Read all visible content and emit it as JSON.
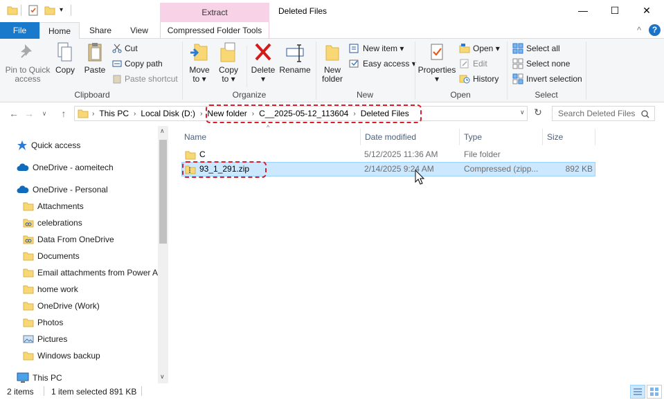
{
  "window": {
    "title": "Deleted Files",
    "context_tab_header": "Extract",
    "minimize": "—",
    "maximize": "☐",
    "close": "✕"
  },
  "ribbon_tabs": {
    "file": "File",
    "home": "Home",
    "share": "Share",
    "view": "View",
    "compressed": "Compressed Folder Tools",
    "collapse_glyph": "^",
    "help_glyph": "?"
  },
  "clipboard": {
    "pin": "Pin to Quick\naccess",
    "copy": "Copy",
    "paste": "Paste",
    "cut": "Cut",
    "copy_path": "Copy path",
    "paste_shortcut": "Paste shortcut",
    "label": "Clipboard"
  },
  "organize": {
    "move_to": "Move\nto ▾",
    "copy_to": "Copy\nto ▾",
    "delete": "Delete\n▾",
    "rename": "Rename",
    "label": "Organize"
  },
  "new": {
    "new_folder": "New\nfolder",
    "new_item": "New item ▾",
    "easy_access": "Easy access ▾",
    "label": "New"
  },
  "open": {
    "properties": "Properties\n▾",
    "open": "Open ▾",
    "edit": "Edit",
    "history": "History",
    "label": "Open"
  },
  "select": {
    "select_all": "Select all",
    "select_none": "Select none",
    "invert": "Invert selection",
    "label": "Select"
  },
  "address": {
    "crumbs": [
      "This PC",
      "Local Disk (D:)",
      "New folder",
      "C__2025-05-12_113604",
      "Deleted Files"
    ],
    "search_placeholder": "Search Deleted Files"
  },
  "nav": [
    {
      "label": "Quick access",
      "icon": "star-icon"
    },
    {
      "label": "OneDrive - aomeitech",
      "icon": "cloud-icon"
    },
    {
      "label": "OneDrive - Personal",
      "icon": "cloud-icon"
    },
    {
      "label": "Attachments",
      "icon": "folder-icon"
    },
    {
      "label": "celebrations",
      "icon": "shared-folder-icon"
    },
    {
      "label": "Data From OneDrive",
      "icon": "shared-folder-icon"
    },
    {
      "label": "Documents",
      "icon": "folder-icon"
    },
    {
      "label": "Email attachments from Power A",
      "icon": "folder-icon"
    },
    {
      "label": "home work",
      "icon": "folder-icon"
    },
    {
      "label": "OneDrive (Work)",
      "icon": "folder-icon"
    },
    {
      "label": "Photos",
      "icon": "folder-icon"
    },
    {
      "label": "Pictures",
      "icon": "pictures-icon"
    },
    {
      "label": "Windows backup",
      "icon": "folder-icon"
    },
    {
      "label": "This PC",
      "icon": "monitor-icon"
    }
  ],
  "columns": {
    "name": "Name",
    "date": "Date modified",
    "type": "Type",
    "size": "Size"
  },
  "files": [
    {
      "name": "C",
      "date": "5/12/2025 11:36 AM",
      "type": "File folder",
      "size": ""
    },
    {
      "name": "93_1_291.zip",
      "date": "2/14/2025 9:24 AM",
      "type": "Compressed (zipp...",
      "size": "892 KB"
    }
  ],
  "status": {
    "items": "2 items",
    "selected": "1 item selected  891 KB"
  }
}
